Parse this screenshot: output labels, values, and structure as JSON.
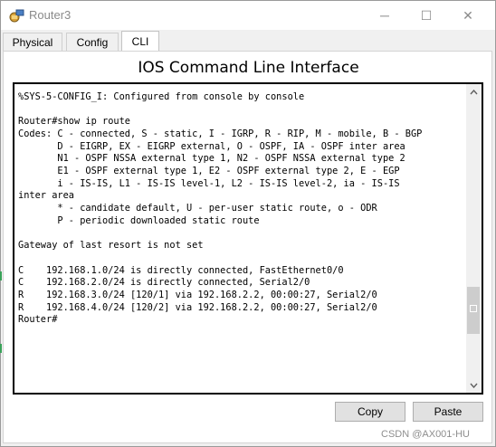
{
  "window": {
    "title": "Router3",
    "icon": "router-app-icon",
    "controls": {
      "minimize": "─",
      "maximize": "☐",
      "close": "✕"
    }
  },
  "tabs": [
    {
      "label": "Physical",
      "active": false
    },
    {
      "label": "Config",
      "active": false
    },
    {
      "label": "CLI",
      "active": true
    }
  ],
  "cli": {
    "heading": "IOS Command Line Interface",
    "lines": [
      "       ",
      "%SYS-5-CONFIG_I: Configured from console by console",
      "",
      "Router#show ip route",
      "Codes: C - connected, S - static, I - IGRP, R - RIP, M - mobile, B - BGP",
      "       D - EIGRP, EX - EIGRP external, O - OSPF, IA - OSPF inter area",
      "       N1 - OSPF NSSA external type 1, N2 - OSPF NSSA external type 2",
      "       E1 - OSPF external type 1, E2 - OSPF external type 2, E - EGP",
      "       i - IS-IS, L1 - IS-IS level-1, L2 - IS-IS level-2, ia - IS-IS",
      "inter area",
      "       * - candidate default, U - per-user static route, o - ODR",
      "       P - periodic downloaded static route",
      "",
      "Gateway of last resort is not set",
      "",
      "C    192.168.1.0/24 is directly connected, FastEthernet0/0",
      "C    192.168.2.0/24 is directly connected, Serial2/0",
      "R    192.168.3.0/24 [120/1] via 192.168.2.2, 00:00:27, Serial2/0",
      "R    192.168.4.0/24 [120/2] via 192.168.2.2, 00:00:27, Serial2/0",
      "Router#"
    ],
    "scroll_position": 0.82
  },
  "buttons": {
    "copy": "Copy",
    "paste": "Paste"
  },
  "watermark": "CSDN @AX001-HU",
  "colors": {
    "window_bg": "#f0f0f0",
    "title_text": "#8a8a8a",
    "terminal_border": "#000000"
  }
}
